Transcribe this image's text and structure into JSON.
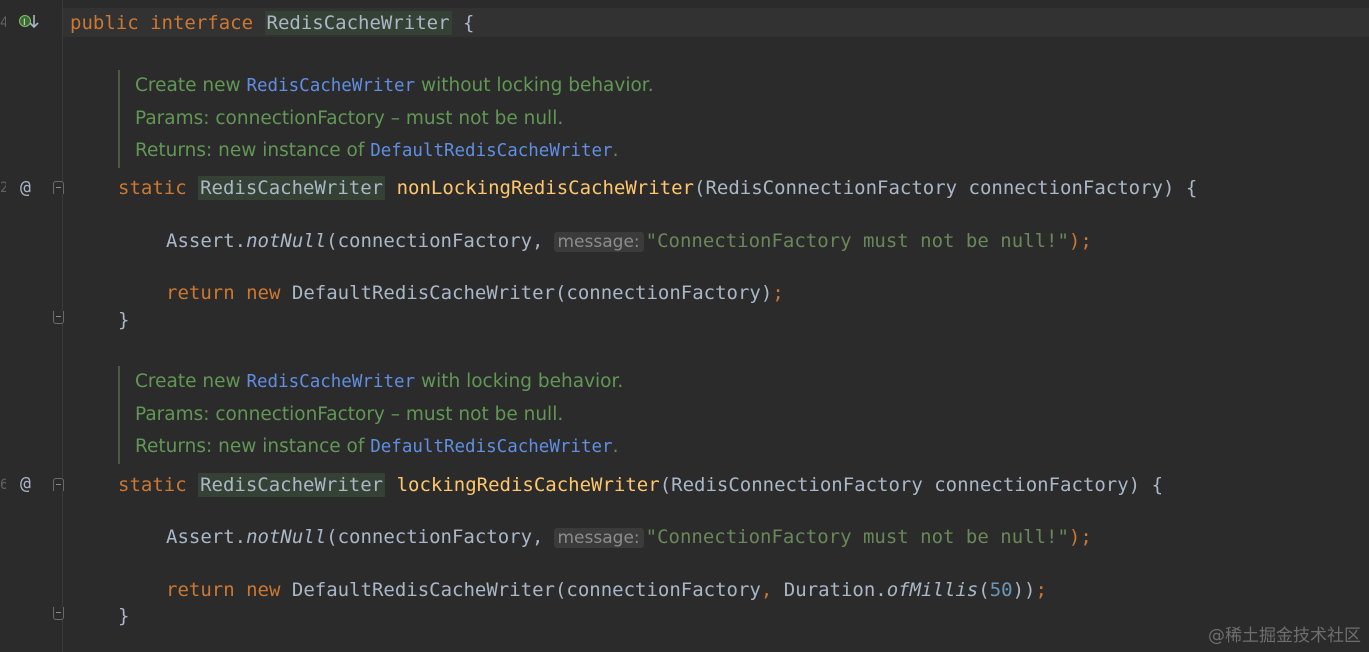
{
  "gutter": {
    "line_numbers": [
      "4",
      "",
      "",
      "",
      "",
      "",
      "",
      "2",
      "",
      "",
      "",
      "",
      "",
      "",
      "",
      "",
      "",
      "",
      "",
      "",
      "",
      "",
      "6",
      "",
      "",
      "",
      "",
      ""
    ],
    "interface_icon": "implemented-interface-icon",
    "override_marker": "@"
  },
  "code": {
    "line1": {
      "k1": "public",
      "k2": "interface",
      "name": "RedisCacheWriter",
      "brace": "{"
    },
    "doc1": {
      "r1a": "Create new ",
      "r1ref": "RedisCacheWriter",
      "r1b": " without locking behavior.",
      "r2": "Params: connectionFactory – must not be null.",
      "r3a": "Returns: new instance of ",
      "r3ref": "DefaultRedisCacheWriter",
      "r3b": "."
    },
    "m1": {
      "k": "static",
      "type": "RedisCacheWriter",
      "fn": "nonLockingRedisCacheWriter",
      "params": "(RedisConnectionFactory connectionFactory) {"
    },
    "m1a": {
      "pre": "Assert.",
      "call": "notNull",
      "arg": "(connectionFactory,",
      "hint": "message:",
      "str": "\"ConnectionFactory must not be null!\"",
      "end": ");"
    },
    "m1r": {
      "ret": "return",
      "nw": "new",
      "rest": "DefaultRedisCacheWriter(connectionFactory)",
      "semi": ";"
    },
    "close1": "}",
    "doc2": {
      "r1a": "Create new ",
      "r1ref": "RedisCacheWriter",
      "r1b": " with locking behavior.",
      "r2": "Params: connectionFactory – must not be null.",
      "r3a": "Returns: new instance of ",
      "r3ref": "DefaultRedisCacheWriter",
      "r3b": "."
    },
    "m2": {
      "k": "static",
      "type": "RedisCacheWriter",
      "fn": "lockingRedisCacheWriter",
      "params": "(RedisConnectionFactory connectionFactory) {"
    },
    "m2a": {
      "pre": "Assert.",
      "call": "notNull",
      "arg": "(connectionFactory,",
      "hint": "message:",
      "str": "\"ConnectionFactory must not be null!\"",
      "end": ");"
    },
    "m2r": {
      "ret": "return",
      "nw": "new",
      "rest1": "DefaultRedisCacheWriter(connectionFactory",
      "comma": ",",
      "rest2": " Duration.",
      "call": "ofMillis",
      "open": "(",
      "num": "50",
      "close": "))",
      "semi": ";"
    },
    "close2": "}"
  },
  "watermark": "@稀土掘金技术社区",
  "colors": {
    "background": "#2b2b2b",
    "keyword": "#cc7832",
    "method": "#ffc66d",
    "string": "#6a8759",
    "doc": "#629755",
    "doc_ref": "#5f8ee2"
  }
}
